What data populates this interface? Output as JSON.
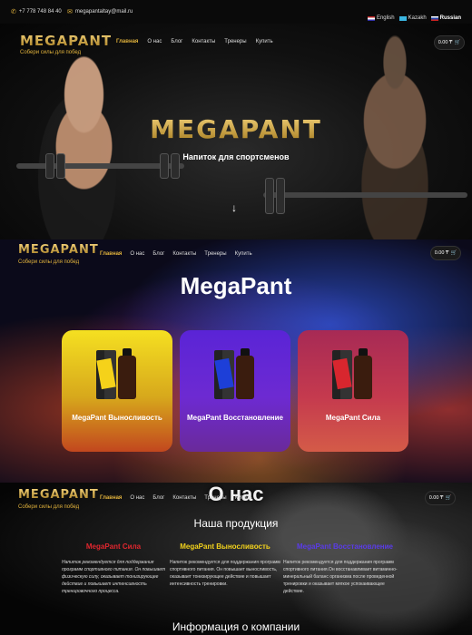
{
  "topbar": {
    "phone": "+7 778 748 84 40",
    "email": "megapantaltay@mail.ru",
    "languages": [
      {
        "label": "English",
        "flag": "flag-en"
      },
      {
        "label": "Kazakh",
        "flag": "flag-kz"
      },
      {
        "label": "Russian",
        "flag": "flag-ru"
      }
    ]
  },
  "brand": {
    "logo": "MEGAPANT",
    "tagline": "Собери силы для побед"
  },
  "nav": {
    "items": [
      "Главная",
      "О нас",
      "Блог",
      "Контакты",
      "Тренеры",
      "Купить"
    ],
    "active": "Главная"
  },
  "cart": {
    "amount": "0.00 ₸",
    "icon": "cart-icon"
  },
  "hero": {
    "title": "MEGAPANT",
    "subtitle": "Напиток для спортсменов",
    "arrow": "↓"
  },
  "products": {
    "title": "MegaPant",
    "cards": [
      {
        "label": "MegaPant Выносливость",
        "box_color": "#f5d21a"
      },
      {
        "label": "MegaPant Восстановление",
        "box_color": "#1d3fd8"
      },
      {
        "label": "MegaPant Сила",
        "box_color": "#d8262e"
      }
    ]
  },
  "about": {
    "title": "О нас",
    "our_products": "Наша продукция",
    "columns": [
      {
        "title": "MegaPant Сила",
        "color": "#e0262e",
        "text": "Напиток рекомендуется для поддержания программ спортивного питания. Он повышает физическую силу, оказывает тонизирующее действие и повышает интенсивность тренировочного процесса."
      },
      {
        "title": "MegaPant Выносливость",
        "color": "#f2d21c",
        "text": "Напиток рекомендуется для поддержания программ спортивного питания. Он повышает выносливость, оказывает тонизирующее действие и повышает интенсивность тренировки."
      },
      {
        "title": "MegaPant Восстановление",
        "color": "#5a3be8",
        "text": "Напиток рекомендуется для поддержания программ спортивного питания.Он восстанавливает витаминно-минеральный баланс организма после проведенной тренировки и оказывает мягкое успокаивающее действие."
      }
    ],
    "info_title": "Информация о компании"
  }
}
